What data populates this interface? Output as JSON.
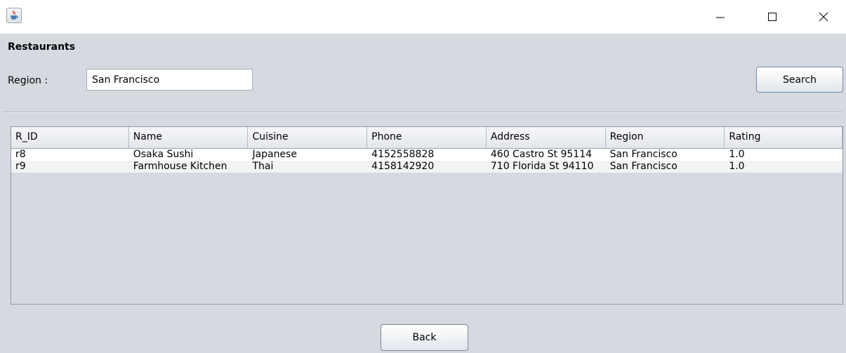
{
  "window": {
    "app_icon": "java-cup-icon",
    "controls": [
      "minimize-icon",
      "maximize-icon",
      "close-icon"
    ]
  },
  "form": {
    "title": "Restaurants",
    "region_label": "Region :",
    "region_value": "San Francisco",
    "search_label": "Search",
    "back_label": "Back"
  },
  "table": {
    "columns": [
      "R_ID",
      "Name",
      "Cuisine",
      "Phone",
      "Address",
      "Region",
      "Rating"
    ],
    "rows": [
      [
        "r8",
        "Osaka Sushi",
        "Japanese",
        "4152558828",
        "460 Castro St 95114",
        "San Francisco",
        "1.0"
      ],
      [
        "r9",
        "Farmhouse Kitchen",
        "Thai",
        "4158142920",
        "710 Florida St 94110",
        "San Francisco",
        "1.0"
      ]
    ]
  }
}
